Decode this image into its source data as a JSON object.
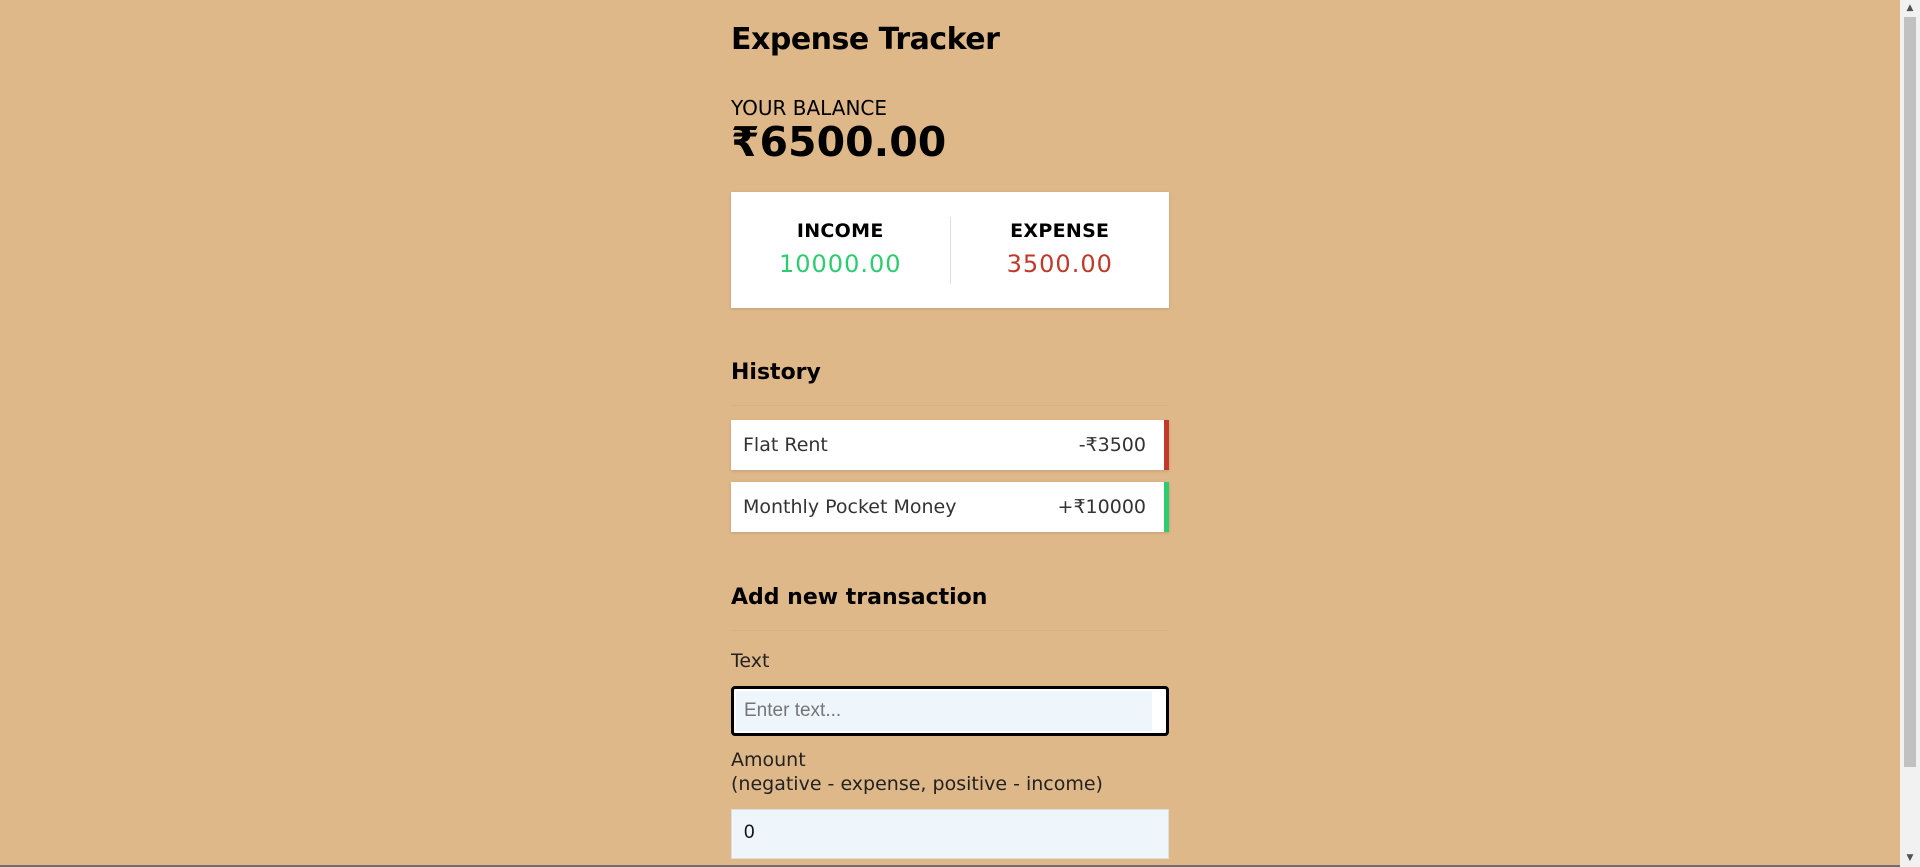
{
  "app": {
    "title": "Expense Tracker"
  },
  "balance": {
    "label": "YOUR BALANCE",
    "value": "₹6500.00"
  },
  "summary": {
    "income_label": "INCOME",
    "income_value": "10000.00",
    "expense_label": "EXPENSE",
    "expense_value": "3500.00"
  },
  "history": {
    "heading": "History",
    "items": [
      {
        "text": "Flat Rent",
        "amount": "-₹3500",
        "kind": "minus"
      },
      {
        "text": "Monthly Pocket Money",
        "amount": "+₹10000",
        "kind": "plus"
      }
    ]
  },
  "form": {
    "heading": "Add new transaction",
    "text_label": "Text",
    "text_placeholder": "Enter text...",
    "text_value": "",
    "amount_label": "Amount",
    "amount_hint": "(negative - expense, positive - income)",
    "amount_value": "0"
  },
  "icons": {
    "scroll_up": "triangle-up-icon",
    "scroll_down": "triangle-down-icon"
  },
  "colors": {
    "background": "#dfb889",
    "income": "#2ecc71",
    "expense": "#c0392b"
  }
}
